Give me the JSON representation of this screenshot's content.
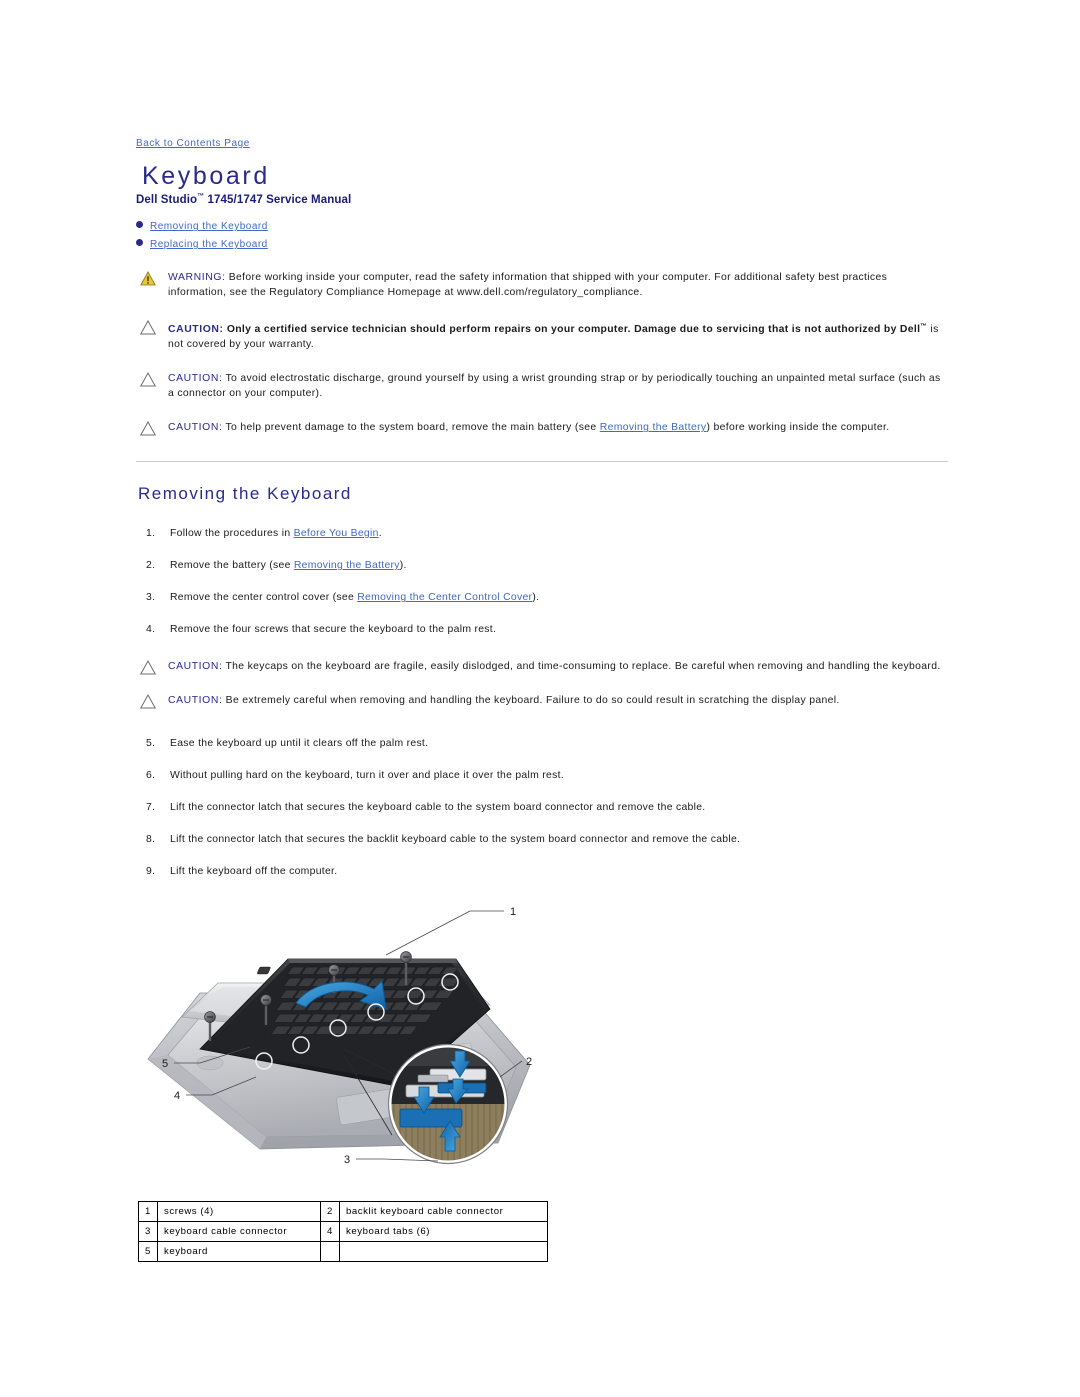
{
  "header": {
    "back_link": "Back to Contents Page",
    "title": "Keyboard",
    "subtitle_pre": "Dell Studio",
    "subtitle_tm": "™",
    "subtitle_post": " 1745/1747 Service Manual"
  },
  "toc": {
    "items": [
      {
        "label": "Removing the Keyboard"
      },
      {
        "label": "Replacing the Keyboard"
      }
    ]
  },
  "notices": [
    {
      "icon": "warning-triangle-icon",
      "keyword": "WARNING:",
      "bold": false,
      "text": " Before working inside your computer, read the safety information that shipped with your computer. For additional safety best practices information, see the Regulatory Compliance Homepage at www.dell.com/regulatory_compliance."
    },
    {
      "icon": "caution-triangle-icon",
      "keyword": "CAUTION:",
      "bold": true,
      "text_pre": " Only a certified service technician should perform repairs on your computer. Damage due to servicing that is not authorized by Dell",
      "tm": "™",
      "text_post": " is not covered by your warranty."
    },
    {
      "icon": "caution-triangle-icon",
      "keyword": "CAUTION:",
      "bold": false,
      "text": " To avoid electrostatic discharge, ground yourself by using a wrist grounding strap or by periodically touching an unpainted metal surface (such as a connector on your computer)."
    },
    {
      "icon": "caution-triangle-icon",
      "keyword": "CAUTION:",
      "bold": false,
      "text_pre": " To help prevent damage to the system board, remove the main battery (see ",
      "link": "Removing the Battery",
      "text_post": ") before working inside the computer."
    }
  ],
  "section": {
    "heading": "Removing the Keyboard"
  },
  "steps_first": [
    {
      "pre": "Follow the procedures in ",
      "link": "Before You Begin",
      "post": "."
    },
    {
      "pre": "Remove the battery (see ",
      "link": "Removing the Battery",
      "post": ")."
    },
    {
      "pre": "Remove the center control cover (see ",
      "link": "Removing the Center Control Cover",
      "post": ")."
    },
    {
      "pre": "Remove the four screws that secure the keyboard to the palm rest.",
      "link": "",
      "post": ""
    }
  ],
  "mid_notices": [
    {
      "icon": "caution-triangle-icon",
      "keyword": "CAUTION:",
      "text": " The keycaps on the keyboard are fragile, easily dislodged, and time-consuming to replace. Be careful when removing and handling the keyboard."
    },
    {
      "icon": "caution-triangle-icon",
      "keyword": "CAUTION:",
      "text": " Be extremely careful when removing and handling the keyboard. Failure to do so could result in scratching the display panel."
    }
  ],
  "steps_second": [
    {
      "pre": "Ease the keyboard up until it clears off the palm rest.",
      "link": "",
      "post": ""
    },
    {
      "pre": "Without pulling hard on the keyboard, turn it over and place it over the palm rest.",
      "link": "",
      "post": ""
    },
    {
      "pre": "Lift the connector latch that secures the keyboard cable to the system board connector and remove the cable.",
      "link": "",
      "post": ""
    },
    {
      "pre": "Lift the connector latch that secures the backlit keyboard cable to the system board connector and remove the cable.",
      "link": "",
      "post": ""
    },
    {
      "pre": "Lift the keyboard off the computer.",
      "link": "",
      "post": ""
    }
  ],
  "figure": {
    "name": "keyboard-removal-diagram",
    "callouts": [
      "1",
      "2",
      "3",
      "4",
      "5"
    ]
  },
  "legend": {
    "rows": [
      {
        "n1": "1",
        "l1": "screws (4)",
        "n2": "2",
        "l2": "backlit keyboard cable connector"
      },
      {
        "n1": "3",
        "l1": "keyboard cable connector",
        "n2": "4",
        "l2": "keyboard tabs (6)"
      },
      {
        "n1": "5",
        "l1": "keyboard",
        "n2": "",
        "l2": ""
      }
    ]
  },
  "colors": {
    "link": "#4169c8",
    "heading": "#2a2a8c",
    "warning_yellow": "#e8c832",
    "rule": "#c6c8cc",
    "callout_blue": "#1a72b8"
  }
}
